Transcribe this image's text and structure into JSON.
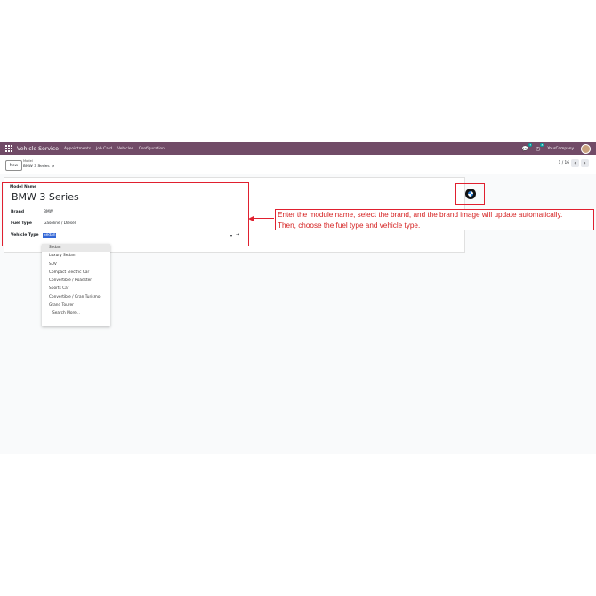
{
  "navbar": {
    "app_title": "Vehicle Service",
    "menu": [
      "Appointments",
      "Job Card",
      "Vehicles",
      "Configuration"
    ],
    "chat_badge": "7",
    "activity_badge": "8",
    "company": "YourCompany"
  },
  "control": {
    "new_label": "New",
    "breadcrumb_parent": "Model",
    "breadcrumb_current": "BMW 3 Series",
    "pager": "1 / 16"
  },
  "form": {
    "model_name_label": "Model Name",
    "model_name": "BMW 3 Series",
    "brand_label": "Brand",
    "brand_value": "BMW",
    "fuel_label": "Fuel Type",
    "fuel_value": "Gasoline / Diesel",
    "vehicle_type_label": "Vehicle Type",
    "vehicle_type_value": "Sedan"
  },
  "dropdown": {
    "options": [
      "Sedan",
      "Luxury Sedan",
      "SUV",
      "Compact Electric Car",
      "Convertible / Roadster",
      "Sports Car",
      "Convertible / Gran Turismo",
      "Grand Tourer"
    ],
    "search_more": "Search More..."
  },
  "annotation": {
    "line1": "Enter the module name, select the brand, and the brand image will update automatically.",
    "line2": "Then, choose the fuel type and vehicle type.",
    "color": "#e0202f"
  },
  "colors": {
    "navbar": "#714b67",
    "selection": "#3367d6"
  },
  "icons": {
    "apps": "apps-grid-icon",
    "chat": "chat-icon",
    "activity": "clock-icon",
    "gear": "gear-icon"
  }
}
